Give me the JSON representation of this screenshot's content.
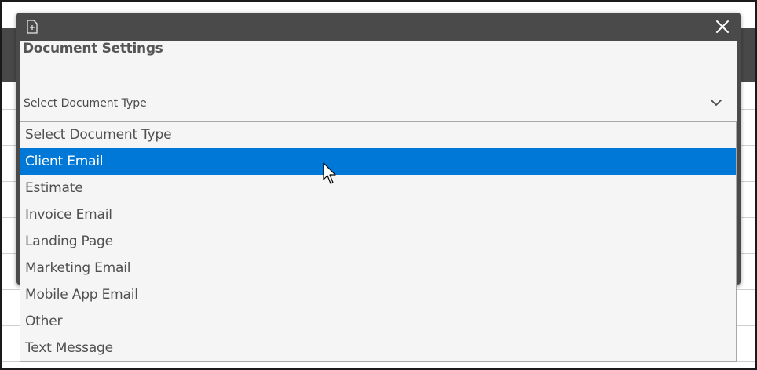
{
  "dialog": {
    "title": "Document Settings",
    "icons": {
      "app": "document-plus-icon",
      "close": "close-icon"
    }
  },
  "select": {
    "value": "Select Document Type",
    "icon": "chevron-down-icon"
  },
  "dropdown": {
    "options": [
      {
        "label": "Select Document Type",
        "highlighted": false
      },
      {
        "label": "Client Email",
        "highlighted": true
      },
      {
        "label": "Estimate",
        "highlighted": false
      },
      {
        "label": "Invoice Email",
        "highlighted": false
      },
      {
        "label": "Landing Page",
        "highlighted": false
      },
      {
        "label": "Marketing Email",
        "highlighted": false
      },
      {
        "label": "Mobile App Email",
        "highlighted": false
      },
      {
        "label": "Other",
        "highlighted": false
      },
      {
        "label": "Text Message",
        "highlighted": false
      }
    ],
    "highlight_color": "#0078d7"
  },
  "colors": {
    "titlebar": "#4a4a4a",
    "dialog_bg": "#f5f5f5"
  }
}
